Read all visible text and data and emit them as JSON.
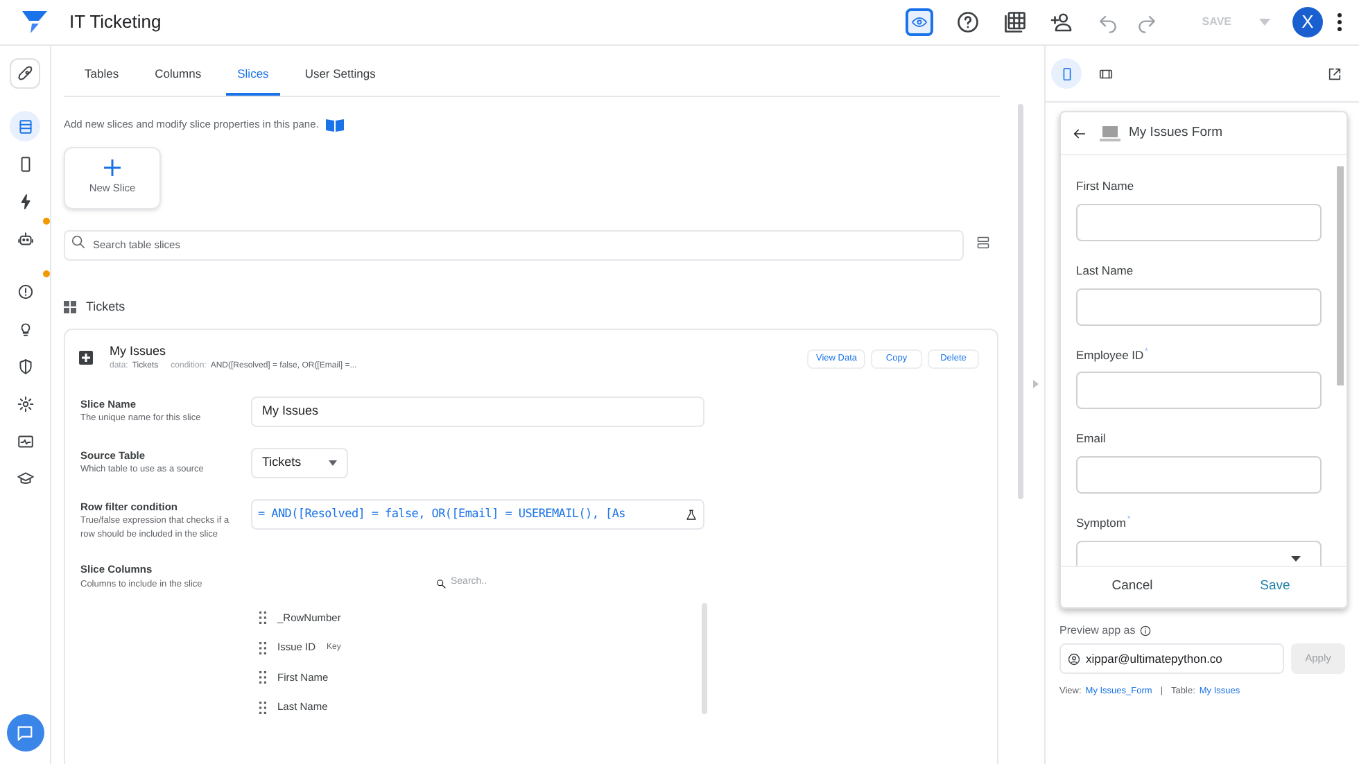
{
  "app": {
    "title": "IT Ticketing",
    "save_button": {
      "label": "SAVE",
      "disabled": true
    },
    "avatar": "X"
  },
  "sidebar": {
    "items": [
      {
        "selected": false,
        "alert": false
      },
      {
        "selected": true,
        "alert": false
      },
      {
        "selected": false,
        "alert": false
      },
      {
        "selected": false,
        "alert": false
      },
      {
        "selected": false,
        "alert": true
      },
      {
        "selected": false,
        "alert": true
      },
      {
        "selected": false,
        "alert": false
      },
      {
        "selected": false,
        "alert": false
      },
      {
        "selected": false,
        "alert": false
      },
      {
        "selected": false,
        "alert": false
      },
      {
        "selected": false,
        "alert": false
      }
    ]
  },
  "tabs": [
    {
      "label": "Tables",
      "selected": false
    },
    {
      "label": "Columns",
      "selected": false
    },
    {
      "label": "Slices",
      "selected": true
    },
    {
      "label": "User Settings",
      "selected": false
    }
  ],
  "hint": "Add new slices and modify slice properties in this pane.",
  "new_slice": {
    "label": "New Slice"
  },
  "search": {
    "placeholder": "Search table slices"
  },
  "section_title": "Tickets",
  "slice": {
    "name": "My Issues",
    "data_label": "data:",
    "data_value": "Tickets",
    "condition_label": "condition:",
    "condition_value": "AND([Resolved] = false, OR([Email] =...",
    "actions": [
      "View Data",
      "Copy",
      "Delete"
    ],
    "slice_name": {
      "label": "Slice Name",
      "help": "The unique name for this slice",
      "value": "My Issues"
    },
    "source_table": {
      "label": "Source Table",
      "help": "Which table to use as a source",
      "value": "Tickets"
    },
    "row_filter": {
      "label": "Row filter condition",
      "help": "True/false expression that checks if a row should be included in the slice",
      "value": "= AND([Resolved] = false, OR([Email] = USEREMAIL(), [As"
    },
    "slice_columns": {
      "label": "Slice Columns",
      "help": "Columns to include in the slice",
      "search_placeholder": "Search..",
      "columns": [
        {
          "name": "_RowNumber"
        },
        {
          "name": "Issue ID",
          "tag": "Key"
        },
        {
          "name": "First Name"
        },
        {
          "name": "Last Name"
        }
      ]
    }
  },
  "preview": {
    "devices": [
      {
        "selected": true
      },
      {
        "selected": false
      }
    ],
    "form": {
      "title": "My Issues Form",
      "fields": [
        {
          "label": "First Name",
          "kind": "text"
        },
        {
          "label": "Last Name",
          "kind": "text"
        },
        {
          "label": "Employee ID",
          "required_mark": "*",
          "kind": "text"
        },
        {
          "label": "Email",
          "kind": "text"
        },
        {
          "label": "Symptom",
          "required_mark": "*",
          "kind": "dropdown"
        }
      ],
      "cancel": "Cancel",
      "save": "Save"
    },
    "preview_as_label": "Preview app as",
    "email": "xippar@ultimatepython.co",
    "apply": {
      "label": "Apply",
      "disabled": true
    },
    "view_label": "View:",
    "view_value": "My Issues_Form",
    "separator": "|",
    "table_label": "Table:",
    "table_value": "My Issues"
  }
}
